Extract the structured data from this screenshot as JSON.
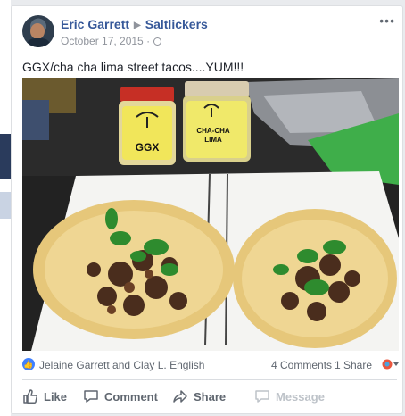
{
  "post": {
    "author": "Eric Garrett",
    "group": "Saltlickers",
    "date": "October 17, 2015",
    "date_separator": "·",
    "more_label": "•••",
    "text": "GGX/cha cha lima street tacos....YUM!!!"
  },
  "photo": {
    "jar_left_label": "GGX",
    "jar_right_label_1": "CHA-CHA",
    "jar_right_label_2": "LIMA"
  },
  "reactions": {
    "names": "Jelaine Garrett and Clay L. English",
    "comments": "4 Comments",
    "shares": "1 Share"
  },
  "actions": {
    "like": "Like",
    "comment": "Comment",
    "share": "Share",
    "message": "Message"
  },
  "colors": {
    "link": "#365899",
    "muted": "#90949c",
    "like_blue": "#4080ff"
  }
}
